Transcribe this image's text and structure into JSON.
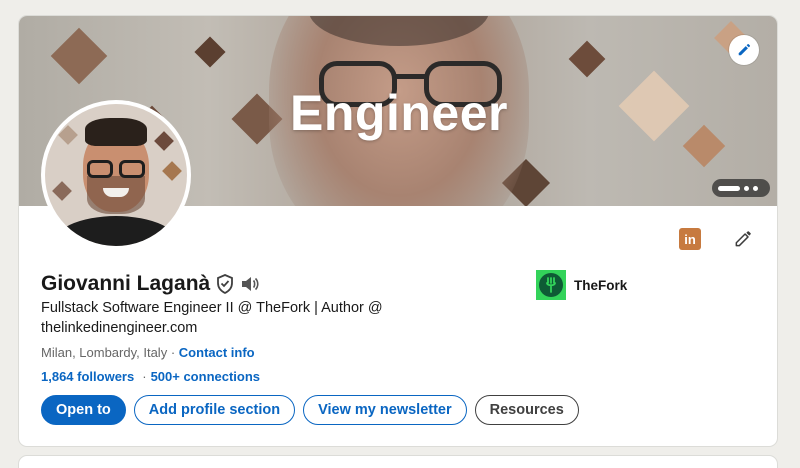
{
  "banner": {
    "title": "Engineer"
  },
  "profile": {
    "name": "Giovanni Laganà",
    "headline": "Fullstack Software Engineer II @ TheFork | Author @ thelinkedinengineer.com",
    "location": "Milan, Lombardy, Italy",
    "location_sep": "·",
    "contact_link": "Contact info",
    "followers": "1,864 followers",
    "stats_sep": "·",
    "connections": "500+ connections"
  },
  "company": {
    "name": "TheFork"
  },
  "badges": {
    "linkedin": "in"
  },
  "actions": {
    "open_to": "Open to",
    "add_profile_section": "Add profile section",
    "view_newsletter": "View my newsletter",
    "resources": "Resources"
  },
  "colors": {
    "link": "#0a66c2",
    "company_green": "#33d35a",
    "linkedin_badge": "#c77a3f"
  },
  "icons": [
    "pencil-icon",
    "verified-shield-icon",
    "speaker-icon",
    "linkedin-icon",
    "carousel-indicator"
  ]
}
